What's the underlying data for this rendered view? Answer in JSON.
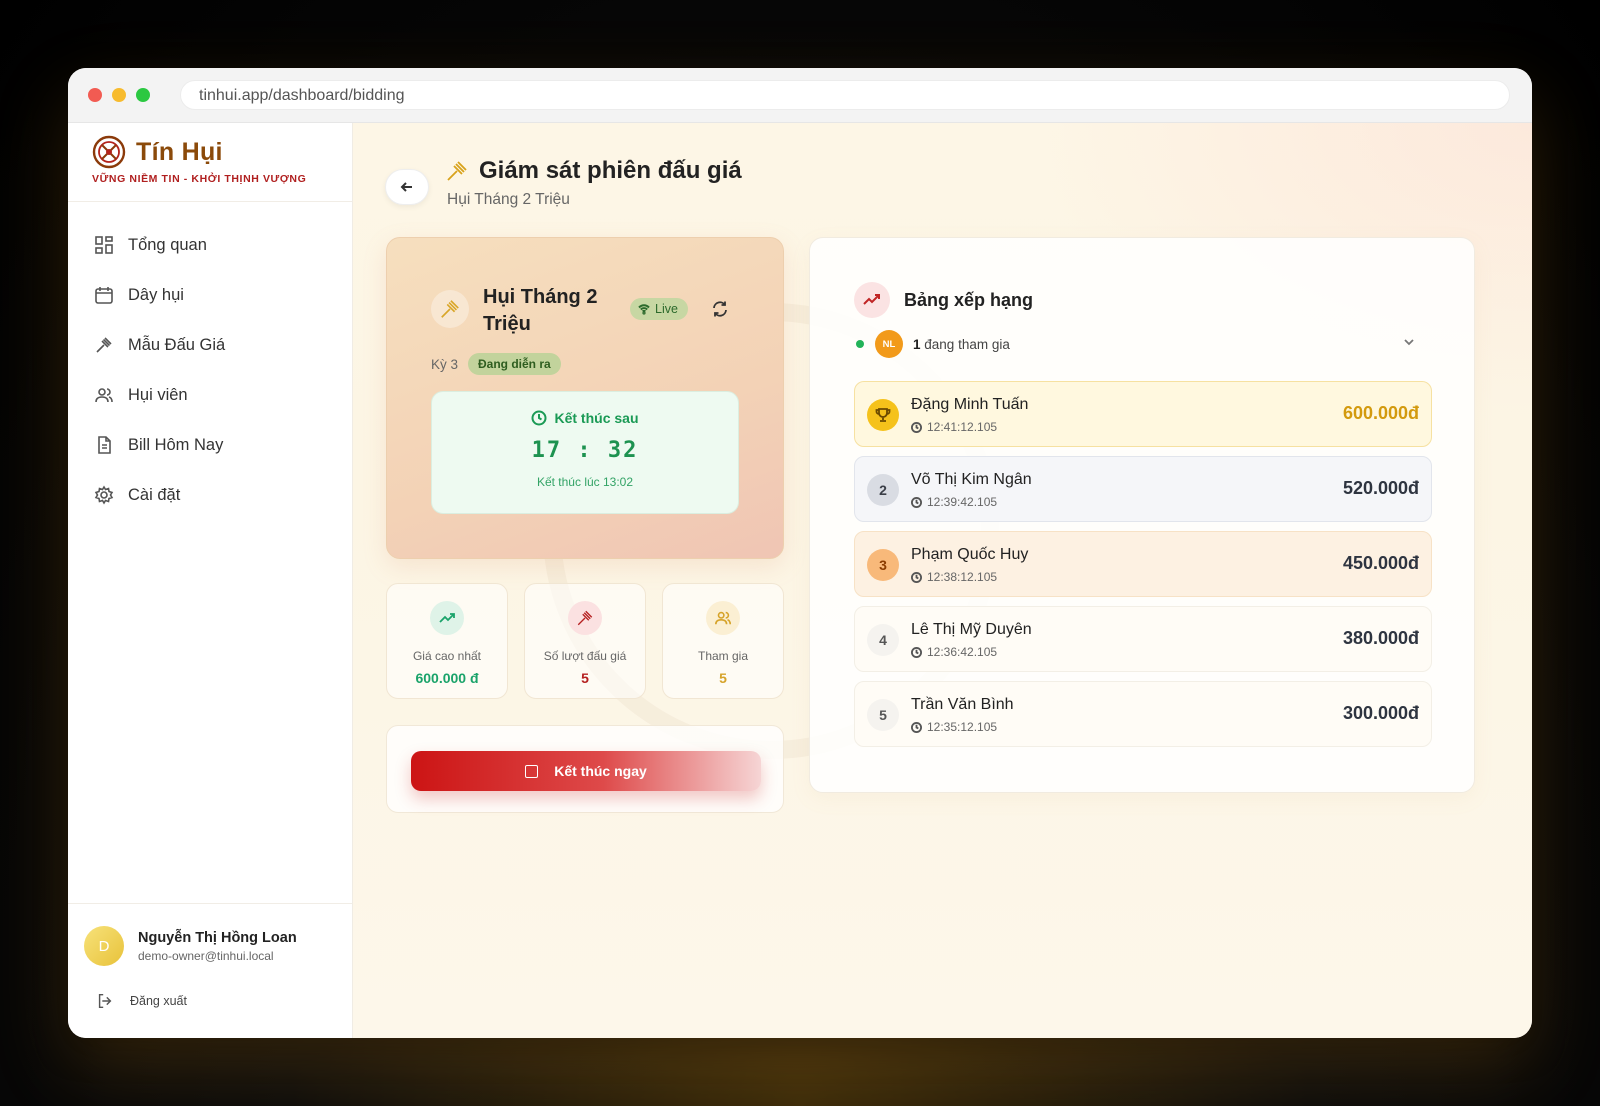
{
  "browser": {
    "url": "tinhui.app/dashboard/bidding"
  },
  "brand": {
    "name": "Tín Hụi",
    "tagline": "VỮNG NIỀM TIN - KHỞI THỊNH VƯỢNG"
  },
  "sidebar": {
    "items": [
      {
        "label": "Tổng quan",
        "icon": "grid-icon"
      },
      {
        "label": "Dây hụi",
        "icon": "calendar-icon"
      },
      {
        "label": "Mẫu Đấu Giá",
        "icon": "gavel-icon"
      },
      {
        "label": "Hụi viên",
        "icon": "users-icon"
      },
      {
        "label": "Bill Hôm Nay",
        "icon": "document-icon"
      },
      {
        "label": "Cài đặt",
        "icon": "gear-icon"
      }
    ],
    "user": {
      "initial": "D",
      "name": "Nguyễn Thị Hồng Loan",
      "email": "demo-owner@tinhui.local"
    },
    "logout_label": "Đăng xuất"
  },
  "header": {
    "title": "Giám sát phiên đấu giá",
    "subtitle": "Hụi Tháng 2 Triệu"
  },
  "auction": {
    "name": "Hụi Tháng 2 Triệu",
    "live_label": "Live",
    "period_label": "Kỳ 3",
    "status_label": "Đang diễn ra",
    "countdown_label": "Kết thúc sau",
    "countdown_value": "17 : 32",
    "end_time_label": "Kết thúc lúc 13:02"
  },
  "stats": [
    {
      "label": "Giá cao nhất",
      "value": "600.000 đ",
      "color": "#1aa36a",
      "icon": "trending-up-icon"
    },
    {
      "label": "Số lượt đấu giá",
      "value": "5",
      "color": "#b52020",
      "icon": "gavel-icon"
    },
    {
      "label": "Tham gia",
      "value": "5",
      "color": "#d6a32a",
      "icon": "users-icon"
    }
  ],
  "end_button_label": "Kết thúc ngay",
  "leaderboard": {
    "title": "Bảng xếp hạng",
    "participant_initials": "NL",
    "participant_count": "1",
    "participant_text": "đang tham gia",
    "rows": [
      {
        "rank": "1",
        "name": "Đặng Minh Tuấn",
        "time": "12:41:12.105",
        "amount": "600.000đ"
      },
      {
        "rank": "2",
        "name": "Võ Thị Kim Ngân",
        "time": "12:39:42.105",
        "amount": "520.000đ"
      },
      {
        "rank": "3",
        "name": "Phạm Quốc Huy",
        "time": "12:38:12.105",
        "amount": "450.000đ"
      },
      {
        "rank": "4",
        "name": "Lê Thị Mỹ Duyên",
        "time": "12:36:42.105",
        "amount": "380.000đ"
      },
      {
        "rank": "5",
        "name": "Trần Văn Bình",
        "time": "12:35:12.105",
        "amount": "300.000đ"
      }
    ]
  },
  "colors": {
    "brand": "#8b4a0a",
    "accent_red": "#cc1414",
    "live_green": "#1d9250",
    "gold": "#d39a0e"
  }
}
